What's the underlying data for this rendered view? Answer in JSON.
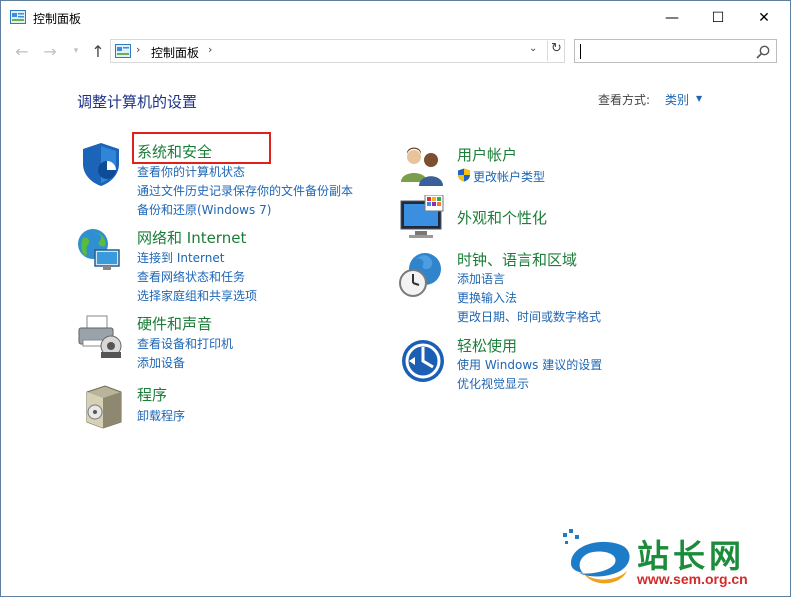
{
  "window": {
    "title": "控制面板",
    "minimize_glyph": "—",
    "maximize_glyph": "☐",
    "close_glyph": "✕"
  },
  "nav": {
    "breadcrumb": "控制面板",
    "search_placeholder": ""
  },
  "header": {
    "title": "调整计算机的设置",
    "view_by_label": "查看方式:",
    "view_by_value": "类别"
  },
  "categories": {
    "system_security": {
      "title": "系统和安全",
      "links": [
        "查看你的计算机状态",
        "通过文件历史记录保存你的文件备份副本",
        "备份和还原(Windows 7)"
      ],
      "icon": "shield-icon"
    },
    "network": {
      "title": "网络和 Internet",
      "links": [
        "连接到 Internet",
        "查看网络状态和任务",
        "选择家庭组和共享选项"
      ],
      "icon": "network-globe-icon"
    },
    "hardware": {
      "title": "硬件和声音",
      "links": [
        "查看设备和打印机",
        "添加设备"
      ],
      "icon": "printer-icon"
    },
    "programs": {
      "title": "程序",
      "links": [
        "卸载程序"
      ],
      "icon": "programs-box-icon"
    },
    "user_accounts": {
      "title": "用户帐户",
      "links": [
        "更改帐户类型"
      ],
      "icon": "users-icon"
    },
    "appearance": {
      "title": "外观和个性化",
      "links": [],
      "icon": "monitor-palette-icon"
    },
    "clock_region": {
      "title": "时钟、语言和区域",
      "links": [
        "添加语言",
        "更换输入法",
        "更改日期、时间或数字格式"
      ],
      "icon": "clock-globe-icon"
    },
    "ease_access": {
      "title": "轻松使用",
      "links": [
        "使用 Windows 建议的设置",
        "优化视觉显示"
      ],
      "icon": "ease-of-access-icon"
    }
  },
  "watermark": {
    "text": "站长网",
    "url": "www.sem.org.cn"
  },
  "colors": {
    "category_title": "#1b7d38",
    "link": "#1e66b4",
    "heading": "#1e3287",
    "highlight_box": "#e0201b"
  }
}
